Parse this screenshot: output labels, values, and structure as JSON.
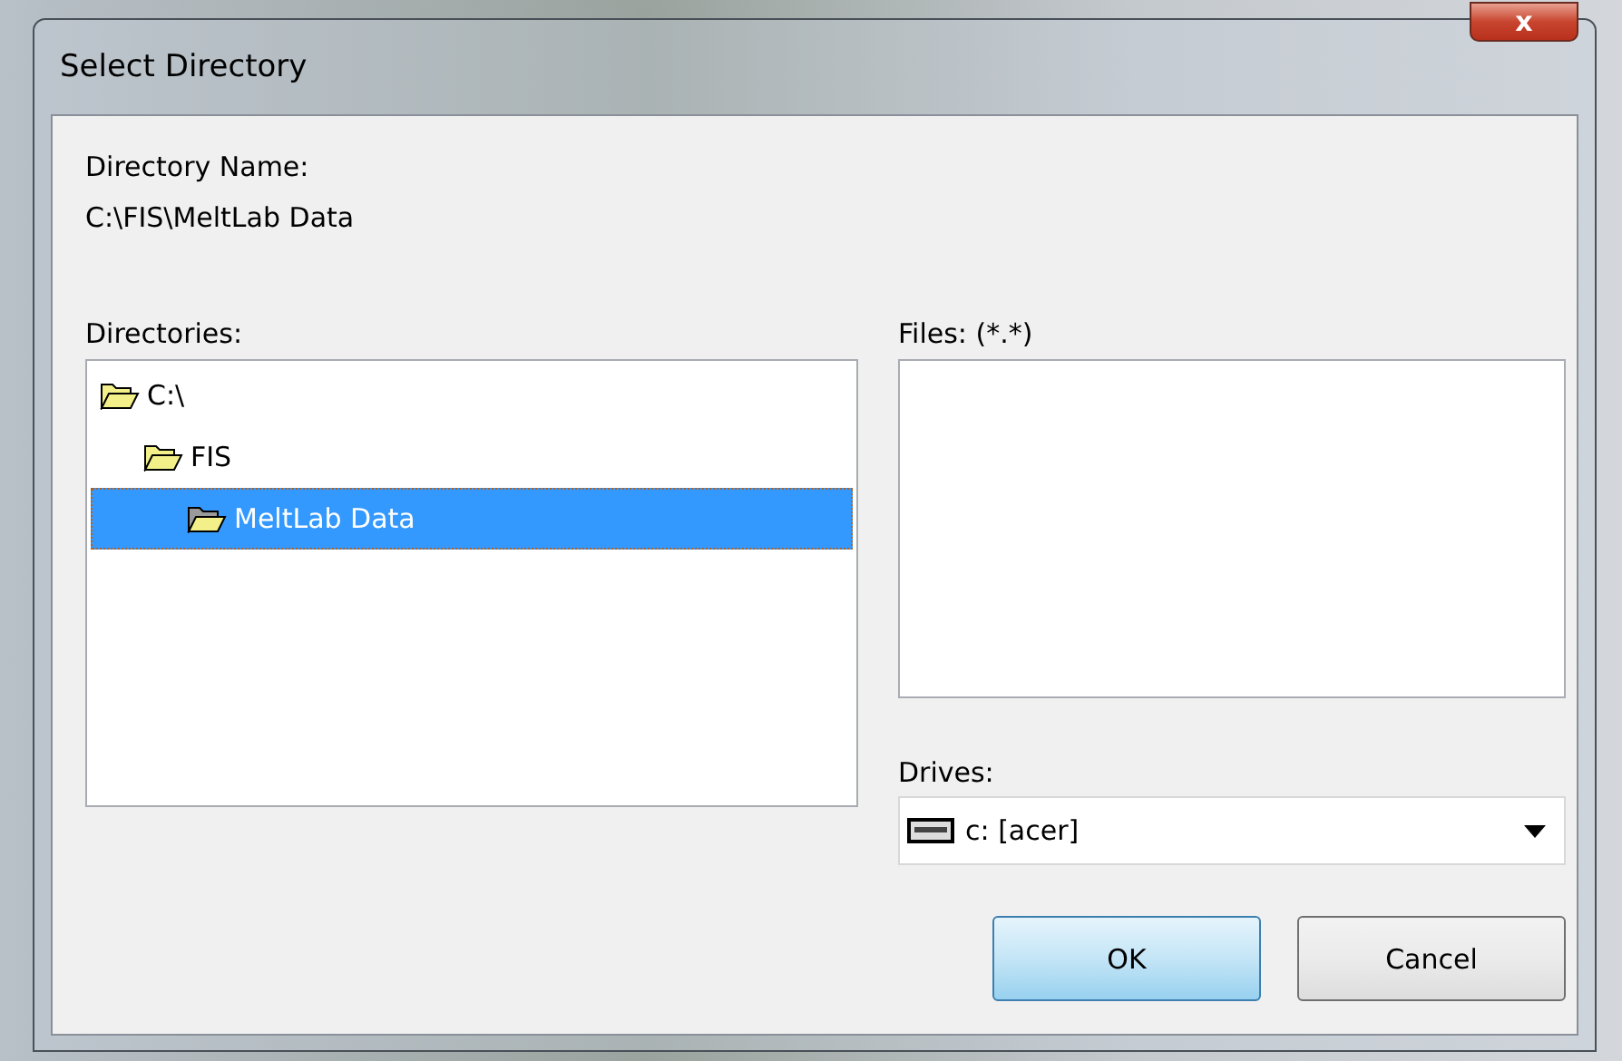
{
  "window": {
    "title": "Select Directory",
    "close": "x"
  },
  "directory_name": {
    "label": "Directory Name:",
    "value": "C:\\FIS\\MeltLab Data"
  },
  "directories": {
    "label": "Directories:",
    "items": [
      {
        "label": "C:\\",
        "selected": false,
        "children": [
          {
            "label": "FIS",
            "selected": false,
            "children": [
              {
                "label": "MeltLab Data",
                "selected": true
              }
            ]
          }
        ]
      }
    ]
  },
  "files": {
    "label": "Files: (*.*)"
  },
  "drives": {
    "label": "Drives:",
    "value": "c: [acer]"
  },
  "buttons": [
    {
      "label": "OK",
      "default": true
    },
    {
      "label": "Cancel",
      "default": false
    }
  ]
}
